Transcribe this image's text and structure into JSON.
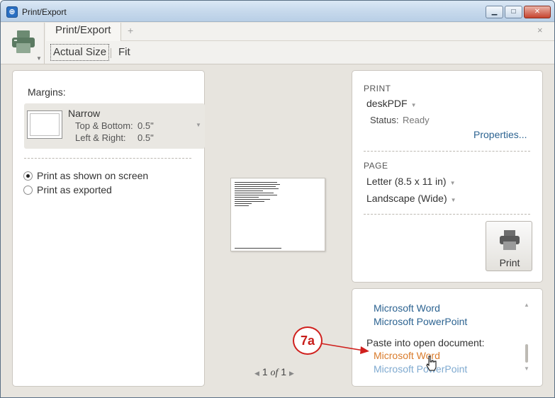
{
  "window": {
    "title": "Print/Export",
    "app_icon": "print-export-icon"
  },
  "title_controls": {
    "minimize": "minimize-icon",
    "maximize": "maximize-icon",
    "close": "close-icon"
  },
  "toolbar": {
    "tab_label": "Print/Export",
    "new_tab_symbol": "+",
    "close_tab_symbol": "×",
    "zoom_actual_label": "Actual Size",
    "zoom_fit_label": "Fit"
  },
  "left": {
    "margins_label": "Margins:",
    "margin_name": "Narrow",
    "top_bottom_label": "Top & Bottom:",
    "top_bottom_value": "0.5\"",
    "left_right_label": "Left & Right:",
    "left_right_value": "0.5\"",
    "radio_options": [
      {
        "label": "Print as shown on screen",
        "selected": true
      },
      {
        "label": "Print as exported",
        "selected": false
      }
    ]
  },
  "preview": {
    "page_current": "1",
    "page_of": "of",
    "page_total": "1"
  },
  "print": {
    "section_label": "PRINT",
    "printer_name": "deskPDF",
    "status_label": "Status:",
    "status_value": "Ready",
    "properties_link": "Properties...",
    "page_section_label": "PAGE",
    "paper_size": "Letter (8.5 x 11 in)",
    "orientation": "Landscape (Wide)",
    "print_button_label": "Print"
  },
  "export": {
    "items": [
      "Microsoft Word",
      "Microsoft PowerPoint"
    ],
    "paste_label": "Paste into open document:",
    "paste_items": [
      "Microsoft Word",
      "Microsoft PowerPoint"
    ]
  },
  "annotation": {
    "callout_label": "7a",
    "callout_color": "#d0201d"
  },
  "colors": {
    "link": "#2c6391",
    "hover_link": "#d97b2b",
    "panel_bg": "#e7e4de"
  }
}
